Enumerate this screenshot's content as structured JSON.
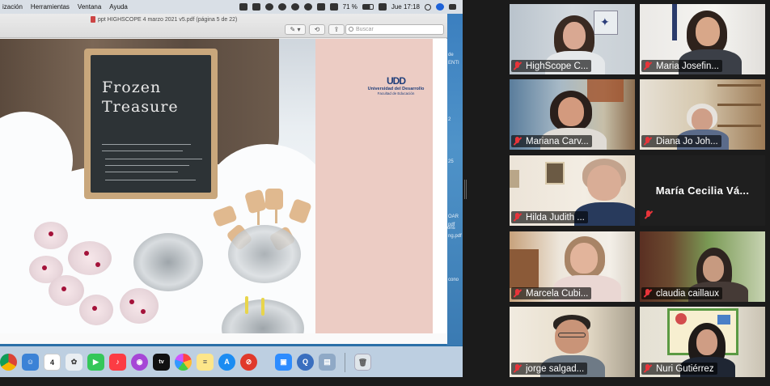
{
  "menubar": {
    "items": [
      "ización",
      "Herramientas",
      "Ventana",
      "Ayuda"
    ],
    "battery": "71 %",
    "clock": "Jue 17:18"
  },
  "pdf_window": {
    "title": "ppt HIGHSCOPE 4 marzo 2021 v5.pdf (página 5 de 22)",
    "search_placeholder": "Buscar"
  },
  "slide": {
    "chalkboard_text": "Frozen Treasure",
    "logo_mark": "UDD",
    "logo_name": "Universidad del Desarrollo",
    "logo_faculty": "Facultad de Educación"
  },
  "desktop_labels": [
    "de",
    "ENTI",
    "2",
    "25",
    "OAR",
    "pdf",
    "ons",
    "ng.pdf",
    "cono"
  ],
  "dock": {
    "calendar_day": "4",
    "items": [
      "chrome-icon",
      "finder-icon",
      "calendar-icon",
      "photos-icon",
      "facetime-icon",
      "music-icon",
      "podcasts-icon",
      "tv-icon",
      "photos-app-icon",
      "notes-icon",
      "app-store-icon",
      "cancel-icon",
      "zoom-icon",
      "quicktime-icon",
      "preview-icon",
      "trash-icon"
    ]
  },
  "participants": [
    {
      "name": "HighScope C...",
      "muted": true,
      "video": true
    },
    {
      "name": "Maria Josefin...",
      "muted": true,
      "video": true
    },
    {
      "name": "Mariana Carv...",
      "muted": true,
      "video": true
    },
    {
      "name": "Diana Jo Joh...",
      "muted": true,
      "video": true
    },
    {
      "name": "Hilda Judith ...",
      "muted": true,
      "video": true
    },
    {
      "name": "María Cecilia Vá...",
      "muted": true,
      "video": false
    },
    {
      "name": "Marcela Cubi...",
      "muted": true,
      "video": true
    },
    {
      "name": "claudia caillaux",
      "muted": true,
      "video": true
    },
    {
      "name": "jorge salgad...",
      "muted": true,
      "video": true
    },
    {
      "name": "Nuri Gutiérrez",
      "muted": true,
      "video": true
    }
  ]
}
